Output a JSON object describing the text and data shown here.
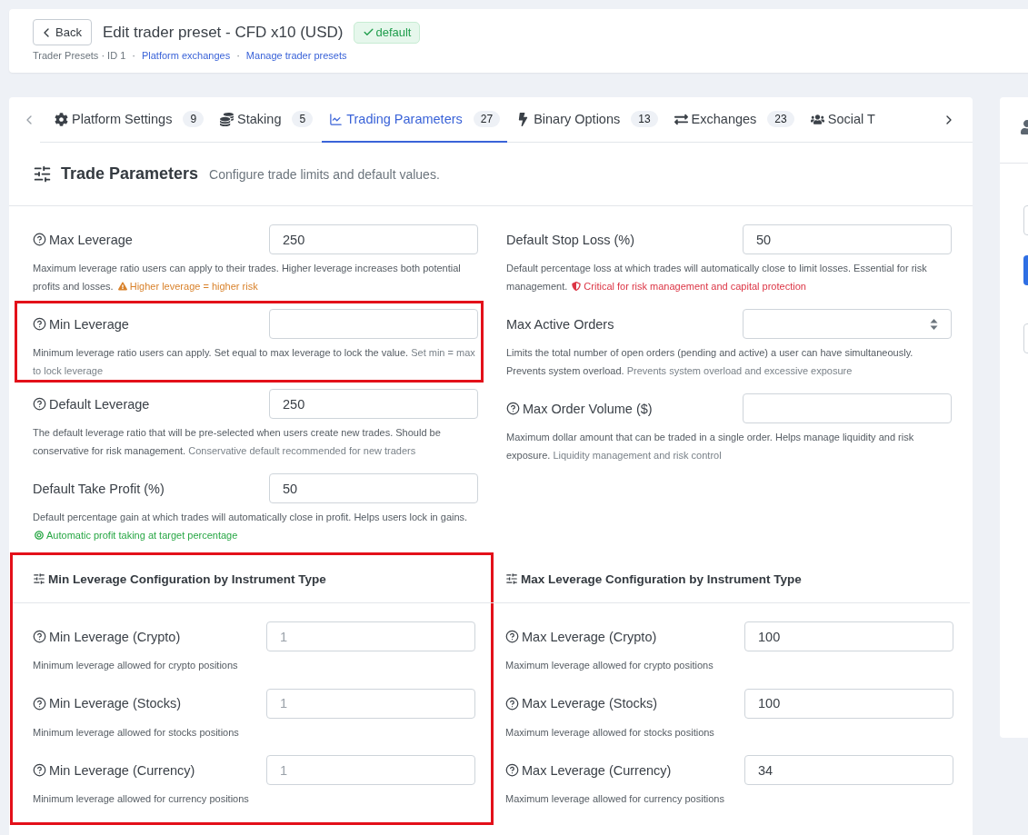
{
  "header": {
    "back_button": "Back",
    "title": "Edit trader preset - CFD x10 (USD)",
    "badge": "default",
    "breadcrumb": [
      {
        "kind": "text",
        "text": "Trader Presets · ID 1"
      },
      {
        "kind": "sep",
        "text": "·"
      },
      {
        "kind": "link",
        "text": "Platform exchanges"
      },
      {
        "kind": "sep",
        "text": "·"
      },
      {
        "kind": "link",
        "text": "Manage trader presets"
      }
    ]
  },
  "tabs": [
    {
      "label": "Platform Settings",
      "count": "9",
      "selected": false
    },
    {
      "label": "Staking",
      "count": "5",
      "selected": false
    },
    {
      "label": "Trading Parameters",
      "count": "27",
      "selected": true
    },
    {
      "label": "Binary Options",
      "count": "13",
      "selected": false
    },
    {
      "label": "Exchanges",
      "count": "23",
      "selected": false
    },
    {
      "label": "Social T",
      "selected": false
    }
  ],
  "section": {
    "title": "Trade Parameters",
    "subtitle": "Configure trade limits and default values."
  },
  "columns": [
    {
      "fields": [
        {
          "label": "Max Leverage",
          "help": true,
          "kind": "text",
          "value": "250",
          "hint": "Maximum leverage ratio users can apply to their trades. Higher leverage increases both potential profits and losses.",
          "note": {
            "kind": "warning",
            "text": "Higher leverage = higher risk"
          },
          "highlighted": false
        },
        {
          "label": "Min Leverage",
          "help": true,
          "kind": "text",
          "hint": "Minimum leverage ratio users can apply. Set equal to max leverage to lock the value.",
          "note": {
            "kind": "muted",
            "text": "Set min = max to lock leverage"
          },
          "highlighted": true
        },
        {
          "label": "Default Leverage",
          "help": true,
          "kind": "text",
          "value": "250",
          "hint": "The default leverage ratio that will be pre-selected when users create new trades. Should be conservative for risk management.",
          "note": {
            "kind": "muted",
            "text": "Conservative default recommended for new traders"
          },
          "highlighted": false
        },
        {
          "label": "Default Take Profit (%)",
          "help": false,
          "kind": "text",
          "value": "50",
          "hint": "Default percentage gain at which trades will automatically close in profit. Helps users lock in gains.",
          "note": {
            "kind": "success",
            "text": "Automatic profit taking at target percentage"
          },
          "highlighted": false
        }
      ]
    },
    {
      "fields": [
        {
          "label": "Default Stop Loss (%)",
          "help": false,
          "kind": "text",
          "value": "50",
          "hint": "Default percentage loss at which trades will automatically close to limit losses. Essential for risk management.",
          "note": {
            "kind": "danger",
            "text": "Critical for risk management and capital protection"
          },
          "highlighted": false
        },
        {
          "label": "Max Active Orders",
          "help": false,
          "kind": "number",
          "hint": "Limits the total number of open orders (pending and active) a user can have simultaneously. Prevents system overload.",
          "note": {
            "kind": "muted",
            "text": "Prevents system overload and excessive exposure"
          },
          "highlighted": false
        },
        {
          "label": "Max Order Volume ($)",
          "help": true,
          "kind": "text",
          "hint": "Maximum dollar amount that can be traded in a single order. Helps manage liquidity and risk exposure.",
          "note": {
            "kind": "muted",
            "text": "Liquidity management and risk control"
          },
          "highlighted": false
        }
      ]
    }
  ],
  "subsections": [
    {
      "title": "Min Leverage Configuration by Instrument Type",
      "highlighted": true,
      "fields": [
        {
          "label": "Min Leverage (Crypto)",
          "help": true,
          "kind": "text",
          "placeholder": "1",
          "hint": "Minimum leverage allowed for crypto positions"
        },
        {
          "label": "Min Leverage (Stocks)",
          "help": true,
          "kind": "text",
          "placeholder": "1",
          "hint": "Minimum leverage allowed for stocks positions"
        },
        {
          "label": "Min Leverage (Currency)",
          "help": true,
          "kind": "text",
          "placeholder": "1",
          "hint": "Minimum leverage allowed for currency positions"
        }
      ]
    },
    {
      "title": "Max Leverage Configuration by Instrument Type",
      "highlighted": false,
      "fields": [
        {
          "label": "Max Leverage (Crypto)",
          "help": true,
          "kind": "text",
          "value": "100",
          "hint": "Maximum leverage allowed for crypto positions"
        },
        {
          "label": "Max Leverage (Stocks)",
          "help": true,
          "kind": "text",
          "value": "100",
          "hint": "Maximum leverage allowed for stocks positions"
        },
        {
          "label": "Max Leverage (Currency)",
          "help": true,
          "kind": "text",
          "value": "34",
          "hint": "Maximum leverage allowed for currency positions"
        }
      ]
    }
  ]
}
